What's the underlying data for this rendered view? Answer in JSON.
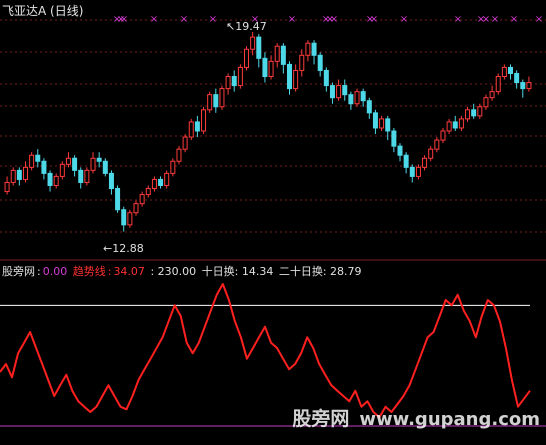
{
  "window": {
    "title": "飞亚达A (日线)"
  },
  "colors": {
    "background": "#000000",
    "up": "#ff3b3b",
    "down": "#4dd9e8",
    "dotted_grid": "#7a1f1f",
    "panel_divider": "#7a1f1f",
    "marker_x": "#d63cd6",
    "trend_line": "#ff2020",
    "level_line": "#ffffff",
    "zero_line": "#c23cc2",
    "text": "#e0e0e0"
  },
  "price_labels": {
    "high": "19.47",
    "low": "12.88"
  },
  "marker_glyph": "×",
  "indicator_legend": {
    "name": "股旁网",
    "sep0": ":",
    "val0": "0.00",
    "trend_label": "趋势线",
    "sep1": ":",
    "trend_value": "34.07",
    "level_text": ": 230.00",
    "ten_day": "十日换: 14.34",
    "twenty_day": "二十日换: 28.79"
  },
  "watermark": {
    "text": "股旁网",
    "url": "www.gupang.com"
  },
  "chart_data": {
    "type": "candlestick",
    "title": "飞亚达A (日线)",
    "price_high_label": 19.47,
    "price_low_label": 12.88,
    "candles": [
      {
        "o": 14.2,
        "c": 14.5,
        "h": 14.7,
        "l": 14.1
      },
      {
        "o": 14.5,
        "c": 14.9,
        "h": 15.0,
        "l": 14.4
      },
      {
        "o": 14.9,
        "c": 14.6,
        "h": 15.0,
        "l": 14.4
      },
      {
        "o": 14.6,
        "c": 15.0,
        "h": 15.2,
        "l": 14.5
      },
      {
        "o": 15.0,
        "c": 15.4,
        "h": 15.5,
        "l": 14.9
      },
      {
        "o": 15.4,
        "c": 15.2,
        "h": 15.6,
        "l": 15.0
      },
      {
        "o": 15.2,
        "c": 14.8,
        "h": 15.3,
        "l": 14.6
      },
      {
        "o": 14.8,
        "c": 14.4,
        "h": 14.9,
        "l": 14.2
      },
      {
        "o": 14.4,
        "c": 14.7,
        "h": 14.8,
        "l": 14.3
      },
      {
        "o": 14.7,
        "c": 15.1,
        "h": 15.2,
        "l": 14.6
      },
      {
        "o": 15.1,
        "c": 15.3,
        "h": 15.5,
        "l": 15.0
      },
      {
        "o": 15.3,
        "c": 14.9,
        "h": 15.4,
        "l": 14.7
      },
      {
        "o": 14.9,
        "c": 14.5,
        "h": 15.0,
        "l": 14.3
      },
      {
        "o": 14.5,
        "c": 14.9,
        "h": 15.0,
        "l": 14.4
      },
      {
        "o": 14.9,
        "c": 15.3,
        "h": 15.5,
        "l": 14.8
      },
      {
        "o": 15.3,
        "c": 15.2,
        "h": 15.5,
        "l": 15.0
      },
      {
        "o": 15.2,
        "c": 14.8,
        "h": 15.3,
        "l": 14.7
      },
      {
        "o": 14.8,
        "c": 14.3,
        "h": 14.9,
        "l": 14.1
      },
      {
        "o": 14.3,
        "c": 13.6,
        "h": 14.4,
        "l": 13.5
      },
      {
        "o": 13.6,
        "c": 13.1,
        "h": 13.7,
        "l": 12.88
      },
      {
        "o": 13.1,
        "c": 13.5,
        "h": 13.6,
        "l": 13.0
      },
      {
        "o": 13.5,
        "c": 13.8,
        "h": 13.9,
        "l": 13.4
      },
      {
        "o": 13.8,
        "c": 14.1,
        "h": 14.2,
        "l": 13.7
      },
      {
        "o": 14.1,
        "c": 14.3,
        "h": 14.4,
        "l": 14.0
      },
      {
        "o": 14.3,
        "c": 14.6,
        "h": 14.7,
        "l": 14.2
      },
      {
        "o": 14.6,
        "c": 14.4,
        "h": 14.7,
        "l": 14.3
      },
      {
        "o": 14.4,
        "c": 14.8,
        "h": 14.9,
        "l": 14.3
      },
      {
        "o": 14.8,
        "c": 15.2,
        "h": 15.3,
        "l": 14.7
      },
      {
        "o": 15.2,
        "c": 15.6,
        "h": 15.7,
        "l": 15.1
      },
      {
        "o": 15.6,
        "c": 16.0,
        "h": 16.1,
        "l": 15.5
      },
      {
        "o": 16.0,
        "c": 16.5,
        "h": 16.6,
        "l": 15.9
      },
      {
        "o": 16.5,
        "c": 16.2,
        "h": 16.7,
        "l": 16.0
      },
      {
        "o": 16.2,
        "c": 16.9,
        "h": 17.0,
        "l": 16.1
      },
      {
        "o": 16.9,
        "c": 17.4,
        "h": 17.5,
        "l": 16.8
      },
      {
        "o": 17.4,
        "c": 17.0,
        "h": 17.6,
        "l": 16.8
      },
      {
        "o": 17.0,
        "c": 17.6,
        "h": 17.7,
        "l": 16.9
      },
      {
        "o": 17.6,
        "c": 18.0,
        "h": 18.1,
        "l": 17.4
      },
      {
        "o": 18.0,
        "c": 17.7,
        "h": 18.2,
        "l": 17.5
      },
      {
        "o": 17.7,
        "c": 18.3,
        "h": 18.4,
        "l": 17.6
      },
      {
        "o": 18.3,
        "c": 18.9,
        "h": 19.0,
        "l": 18.2
      },
      {
        "o": 18.9,
        "c": 19.3,
        "h": 19.47,
        "l": 18.7
      },
      {
        "o": 19.3,
        "c": 18.6,
        "h": 19.4,
        "l": 18.3
      },
      {
        "o": 18.6,
        "c": 18.0,
        "h": 18.8,
        "l": 17.8
      },
      {
        "o": 18.0,
        "c": 18.5,
        "h": 18.7,
        "l": 17.9
      },
      {
        "o": 18.5,
        "c": 19.0,
        "h": 19.1,
        "l": 18.3
      },
      {
        "o": 19.0,
        "c": 18.4,
        "h": 19.1,
        "l": 18.1
      },
      {
        "o": 18.4,
        "c": 17.6,
        "h": 18.5,
        "l": 17.4
      },
      {
        "o": 17.6,
        "c": 18.2,
        "h": 18.4,
        "l": 17.5
      },
      {
        "o": 18.2,
        "c": 18.7,
        "h": 18.9,
        "l": 18.0
      },
      {
        "o": 18.7,
        "c": 19.1,
        "h": 19.2,
        "l": 18.5
      },
      {
        "o": 19.1,
        "c": 18.7,
        "h": 19.2,
        "l": 18.4
      },
      {
        "o": 18.7,
        "c": 18.2,
        "h": 18.8,
        "l": 18.0
      },
      {
        "o": 18.2,
        "c": 17.7,
        "h": 18.3,
        "l": 17.5
      },
      {
        "o": 17.7,
        "c": 17.3,
        "h": 17.8,
        "l": 17.1
      },
      {
        "o": 17.3,
        "c": 17.7,
        "h": 17.9,
        "l": 17.2
      },
      {
        "o": 17.7,
        "c": 17.4,
        "h": 17.9,
        "l": 17.2
      },
      {
        "o": 17.4,
        "c": 17.1,
        "h": 17.5,
        "l": 16.9
      },
      {
        "o": 17.1,
        "c": 17.5,
        "h": 17.6,
        "l": 17.0
      },
      {
        "o": 17.5,
        "c": 17.2,
        "h": 17.6,
        "l": 17.0
      },
      {
        "o": 17.2,
        "c": 16.8,
        "h": 17.3,
        "l": 16.6
      },
      {
        "o": 16.8,
        "c": 16.3,
        "h": 16.9,
        "l": 16.1
      },
      {
        "o": 16.3,
        "c": 16.6,
        "h": 16.7,
        "l": 16.2
      },
      {
        "o": 16.6,
        "c": 16.2,
        "h": 16.7,
        "l": 15.9
      },
      {
        "o": 16.2,
        "c": 15.7,
        "h": 16.3,
        "l": 15.5
      },
      {
        "o": 15.7,
        "c": 15.4,
        "h": 15.8,
        "l": 15.2
      },
      {
        "o": 15.4,
        "c": 15.0,
        "h": 15.5,
        "l": 14.8
      },
      {
        "o": 15.0,
        "c": 14.7,
        "h": 15.1,
        "l": 14.5
      },
      {
        "o": 14.7,
        "c": 15.0,
        "h": 15.1,
        "l": 14.6
      },
      {
        "o": 15.0,
        "c": 15.3,
        "h": 15.4,
        "l": 14.9
      },
      {
        "o": 15.3,
        "c": 15.6,
        "h": 15.7,
        "l": 15.2
      },
      {
        "o": 15.6,
        "c": 15.9,
        "h": 16.0,
        "l": 15.5
      },
      {
        "o": 15.9,
        "c": 16.2,
        "h": 16.3,
        "l": 15.8
      },
      {
        "o": 16.2,
        "c": 16.5,
        "h": 16.6,
        "l": 16.1
      },
      {
        "o": 16.5,
        "c": 16.3,
        "h": 16.7,
        "l": 16.2
      },
      {
        "o": 16.3,
        "c": 16.6,
        "h": 16.7,
        "l": 16.2
      },
      {
        "o": 16.6,
        "c": 16.9,
        "h": 17.0,
        "l": 16.5
      },
      {
        "o": 16.9,
        "c": 16.7,
        "h": 17.1,
        "l": 16.6
      },
      {
        "o": 16.7,
        "c": 17.0,
        "h": 17.1,
        "l": 16.6
      },
      {
        "o": 17.0,
        "c": 17.3,
        "h": 17.4,
        "l": 16.9
      },
      {
        "o": 17.3,
        "c": 17.5,
        "h": 17.7,
        "l": 17.2
      },
      {
        "o": 17.5,
        "c": 18.0,
        "h": 18.1,
        "l": 17.4
      },
      {
        "o": 18.0,
        "c": 18.3,
        "h": 18.4,
        "l": 17.9
      },
      {
        "o": 18.3,
        "c": 18.1,
        "h": 18.4,
        "l": 17.9
      },
      {
        "o": 18.1,
        "c": 17.8,
        "h": 18.2,
        "l": 17.6
      },
      {
        "o": 17.8,
        "c": 17.6,
        "h": 17.9,
        "l": 17.3
      },
      {
        "o": 17.6,
        "c": 17.8,
        "h": 18.0,
        "l": 17.5
      }
    ],
    "indicator_level": 230.0,
    "indicator_range": [
      0,
      270
    ],
    "trend_line": [
      105,
      120,
      95,
      140,
      160,
      180,
      150,
      120,
      90,
      60,
      80,
      100,
      70,
      50,
      40,
      30,
      40,
      60,
      80,
      60,
      40,
      35,
      60,
      90,
      110,
      130,
      150,
      170,
      200,
      230,
      210,
      160,
      140,
      160,
      190,
      220,
      250,
      270,
      240,
      200,
      170,
      130,
      150,
      170,
      190,
      160,
      150,
      130,
      110,
      120,
      140,
      170,
      150,
      120,
      100,
      80,
      70,
      60,
      50,
      70,
      40,
      50,
      30,
      20,
      40,
      30,
      45,
      60,
      80,
      110,
      140,
      170,
      180,
      210,
      240,
      230,
      250,
      220,
      200,
      170,
      210,
      240,
      230,
      200,
      150,
      90,
      40,
      55,
      70
    ]
  }
}
